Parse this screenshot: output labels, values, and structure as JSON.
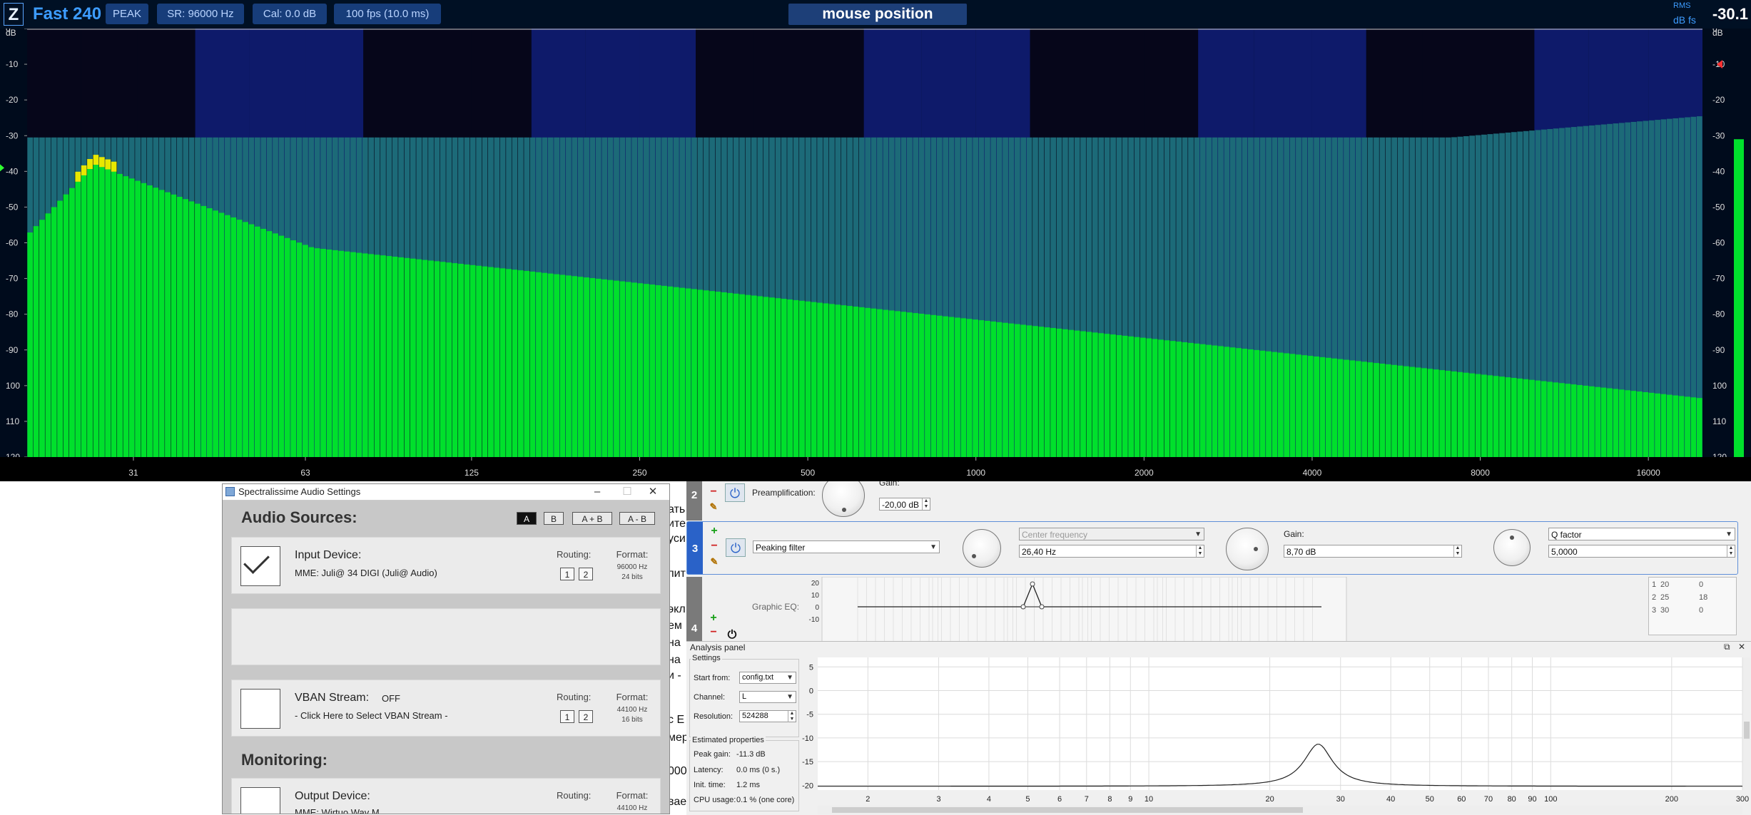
{
  "topbar": {
    "logo": "Z",
    "title": "Fast 240",
    "peak": "PEAK",
    "sr": "SR: 96000 Hz",
    "cal": "Cal:  0.0 dB",
    "fps": "100 fps (10.0 ms)",
    "mouse_position": "mouse position",
    "rms_label": "RMS",
    "dbfs_label": "dB fs",
    "rms_value": "-30.1"
  },
  "spectrum": {
    "unit": "dB",
    "y_ticks": [
      "0",
      "-10",
      "-20",
      "-30",
      "-40",
      "-50",
      "-60",
      "-70",
      "-80",
      "-90",
      "100",
      "110",
      "120"
    ],
    "x_ticks": [
      "31",
      "63",
      "125",
      "250",
      "500",
      "1000",
      "2000",
      "4000",
      "8000",
      "16000"
    ],
    "x_tick_freqs": [
      31,
      63,
      125,
      250,
      500,
      1000,
      2000,
      4000,
      8000,
      16000
    ],
    "y_range": [
      0,
      -120
    ],
    "freq_range": [
      20,
      20000
    ],
    "colors": {
      "bar": "#00e02c",
      "peak_hold": "#1c6a78",
      "clip": "#e8e800",
      "bg_dark": "#06061a",
      "bg_blue": "#0e1a6a"
    }
  },
  "audio_window": {
    "title": "Spectralissime Audio Settings",
    "minimize": "–",
    "maximize": "☐",
    "close": "✕",
    "sources_title": "Audio Sources:",
    "ab_buttons": [
      "A",
      "B",
      "A + B",
      "A - B"
    ],
    "input_device": {
      "title": "Input Device:",
      "name": "MME: Juli@ 34 DIGI (Juli@ Audio)",
      "routing_label": "Routing:",
      "routing": [
        "1",
        "2"
      ],
      "format_label": "Format:",
      "format_rate": "96000 Hz",
      "format_bits": "24 bits"
    },
    "vban": {
      "title": "VBAN Stream:",
      "state": "OFF",
      "hint": "- Click Here to Select VBAN Stream -",
      "routing_label": "Routing:",
      "routing": [
        "1",
        "2"
      ],
      "format_label": "Format:",
      "format_rate": "44100 Hz",
      "format_bits": "16 bits"
    },
    "monitoring_title": "Monitoring:",
    "output_device": {
      "title": "Output Device:",
      "name": "MME: Wirtuo Wav M...",
      "routing_label": "Routing:",
      "format_label": "Format:",
      "format_rate": "44100 Hz"
    }
  },
  "background_text": {
    "lines": [
      "ать",
      "ите",
      "уси",
      "пит",
      "экл",
      "ем",
      "на",
      "на",
      "и -",
      "с Е",
      "мер",
      "000",
      "вае"
    ]
  },
  "eq": {
    "row2": {
      "num": "2",
      "label": "Preamplification:",
      "gain_label": "Gain:",
      "gain_value": "-20,00 dB"
    },
    "row3": {
      "num": "3",
      "filter_type": "Peaking filter",
      "freq_type": "Center frequency",
      "freq_value": "26,40 Hz",
      "gain_label": "Gain:",
      "gain_value": "8,70 dB",
      "q_type": "Q factor",
      "q_value": "5,0000"
    },
    "row4": {
      "num": "4",
      "label": "Graphic EQ:",
      "y_ticks": [
        "20",
        "10",
        "0",
        "-10"
      ],
      "table": [
        {
          "idx": "1",
          "freq": "20",
          "gain": "0"
        },
        {
          "idx": "2",
          "freq": "25",
          "gain": "18"
        },
        {
          "idx": "3",
          "freq": "30",
          "gain": "0"
        }
      ]
    }
  },
  "analysis": {
    "title": "Analysis panel",
    "restore": "⧉",
    "close": "✕",
    "settings_label": "Settings",
    "start_from_label": "Start from:",
    "start_from_value": "config.txt",
    "channel_label": "Channel:",
    "channel_value": "L",
    "resolution_label": "Resolution:",
    "resolution_value": "524288",
    "estimated_label": "Estimated properties",
    "peak_gain_label": "Peak gain:",
    "peak_gain_value": "-11.3 dB",
    "latency_label": "Latency:",
    "latency_value": "0.0 ms (0 s.)",
    "init_time_label": "Init. time:",
    "init_time_value": "1.2 ms",
    "cpu_label": "CPU usage:",
    "cpu_value": "0.1 % (one core)",
    "chart_data": {
      "type": "line",
      "x_ticks": [
        "2",
        "3",
        "4",
        "5",
        "6",
        "7",
        "8",
        "9",
        "10",
        "20",
        "30",
        "40",
        "50",
        "60",
        "70",
        "80",
        "90",
        "100",
        "200",
        "300"
      ],
      "y_ticks": [
        "5",
        "0",
        "-5",
        "-10",
        "-15",
        "-20"
      ],
      "x_range": [
        1.5,
        300
      ],
      "ylim": [
        -21,
        7
      ],
      "peak_freq": 26.4,
      "peak_gain": -11.3
    }
  }
}
